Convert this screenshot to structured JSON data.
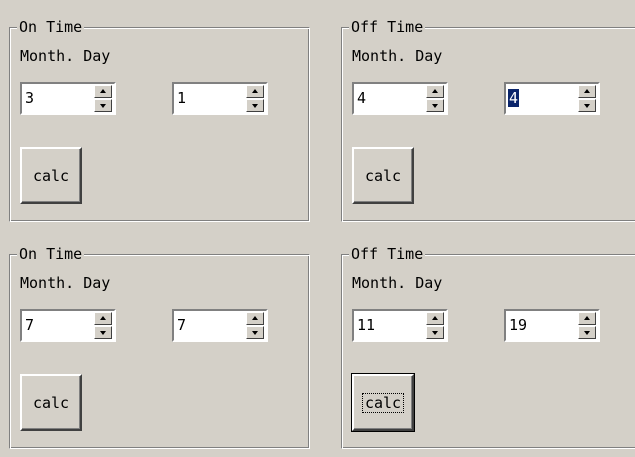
{
  "groups": [
    {
      "title": "On Time",
      "sublabel": "Month. Day",
      "month": "3",
      "day": "1",
      "calc_label": "calc"
    },
    {
      "title": "Off Time",
      "sublabel": "Month. Day",
      "month": "4",
      "day": "4",
      "calc_label": "calc"
    },
    {
      "title": "On Time",
      "sublabel": "Month. Day",
      "month": "7",
      "day": "7",
      "calc_label": "calc"
    },
    {
      "title": "Off Time",
      "sublabel": "Month. Day",
      "month": "11",
      "day": "19",
      "calc_label": "calc"
    }
  ]
}
